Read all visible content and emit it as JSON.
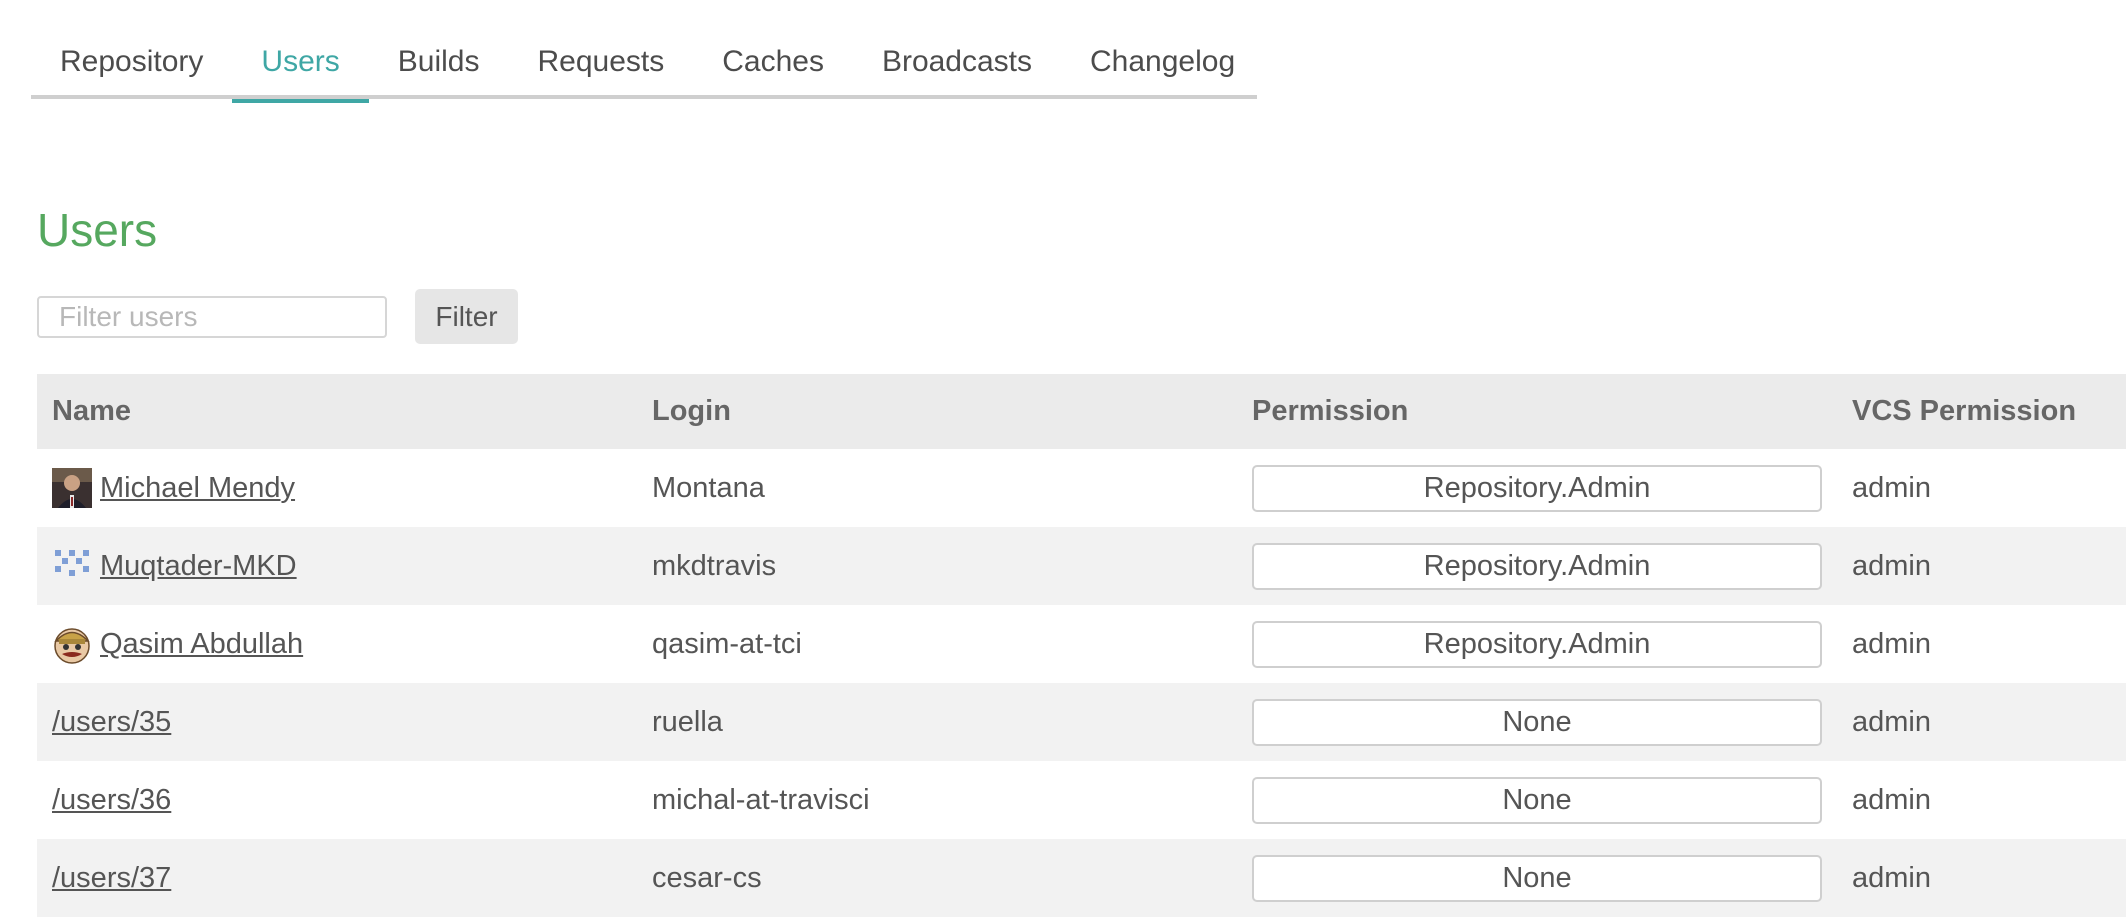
{
  "tabs": [
    {
      "label": "Repository",
      "active": false
    },
    {
      "label": "Users",
      "active": true
    },
    {
      "label": "Builds",
      "active": false
    },
    {
      "label": "Requests",
      "active": false
    },
    {
      "label": "Caches",
      "active": false
    },
    {
      "label": "Broadcasts",
      "active": false
    },
    {
      "label": "Changelog",
      "active": false
    }
  ],
  "page": {
    "title": "Users"
  },
  "filter": {
    "placeholder": "Filter users",
    "value": "",
    "button_label": "Filter"
  },
  "table": {
    "headers": {
      "name": "Name",
      "login": "Login",
      "permission": "Permission",
      "vcs_permission": "VCS Permission"
    },
    "rows": [
      {
        "name": "Michael Mendy",
        "avatar": "photo-avatar",
        "login": "Montana",
        "permission": "Repository.Admin",
        "vcs_permission": "admin"
      },
      {
        "name": "Muqtader-MKD",
        "avatar": "identicon-avatar",
        "login": "mkdtravis",
        "permission": "Repository.Admin",
        "vcs_permission": "admin"
      },
      {
        "name": "Qasim Abdullah",
        "avatar": "mascot-avatar",
        "login": "qasim-at-tci",
        "permission": "Repository.Admin",
        "vcs_permission": "admin"
      },
      {
        "name": "/users/35",
        "avatar": "",
        "login": "ruella",
        "permission": "None",
        "vcs_permission": "admin"
      },
      {
        "name": "/users/36",
        "avatar": "",
        "login": "michal-at-travisci",
        "permission": "None",
        "vcs_permission": "admin"
      },
      {
        "name": "/users/37",
        "avatar": "",
        "login": "cesar-cs",
        "permission": "None",
        "vcs_permission": "admin"
      }
    ]
  },
  "colors": {
    "accent": "#3fa7a5",
    "title": "#56a85f",
    "header_bg": "#ebebeb",
    "row_alt": "#f2f2f2"
  }
}
